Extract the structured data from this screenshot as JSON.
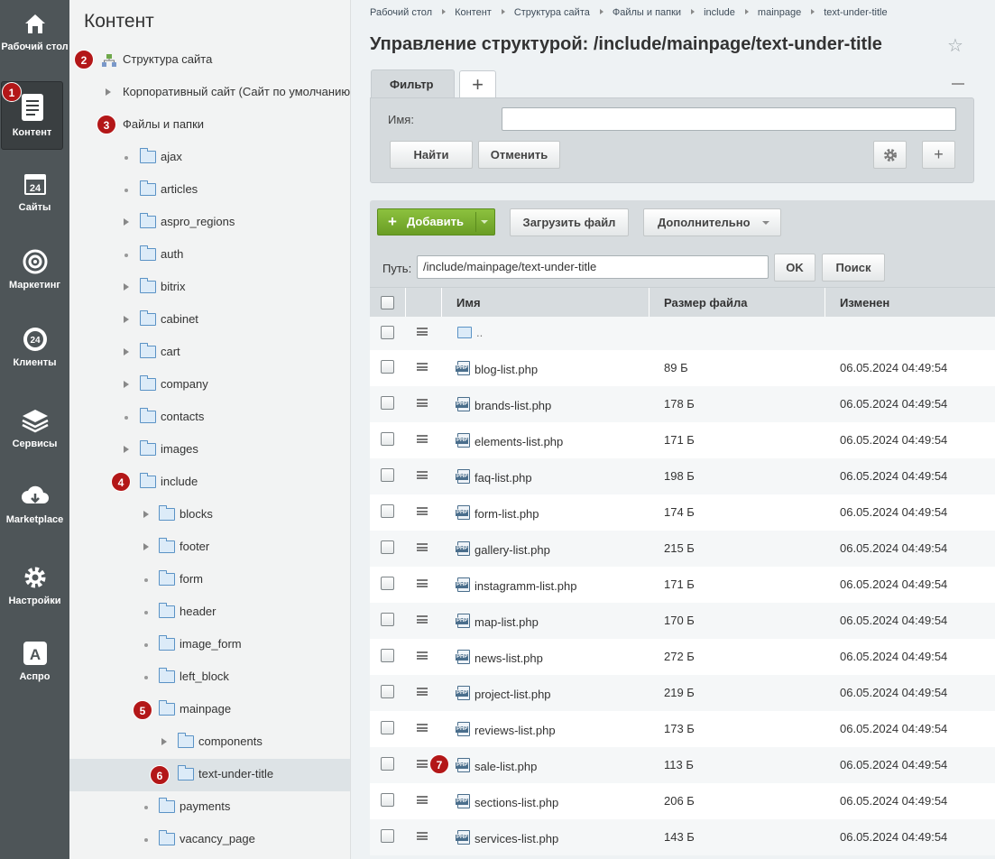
{
  "rail": [
    {
      "label": "Рабочий стол",
      "icon": "home-icon"
    },
    {
      "label": "Контент",
      "icon": "document-icon",
      "active": true
    },
    {
      "label": "Сайты",
      "icon": "calendar-24-icon"
    },
    {
      "label": "Маркетинг",
      "icon": "target-icon"
    },
    {
      "label": "Клиенты",
      "icon": "clients-24-icon"
    },
    {
      "label": "Сервисы",
      "icon": "layers-icon"
    },
    {
      "label": "Marketplace",
      "icon": "cloud-download-icon"
    },
    {
      "label": "Настройки",
      "icon": "gear-icon"
    },
    {
      "label": "Аспро",
      "icon": "aspro-a-icon"
    }
  ],
  "rail_badge": "1",
  "tree": {
    "title": "Контент",
    "site_structure": "Структура сайта",
    "corporate_site": "Корпоративный сайт (Сайт по умолчанию)",
    "files_and_folders": "Файлы и папки",
    "badges": {
      "site_structure": "2",
      "files_and_folders": "3",
      "include": "4",
      "mainpage": "5",
      "text_under_title": "6"
    },
    "items": [
      "ajax",
      "articles",
      "aspro_regions",
      "auth",
      "bitrix",
      "cabinet",
      "cart",
      "company",
      "contacts",
      "images",
      "include",
      "blocks",
      "footer",
      "form",
      "header",
      "image_form",
      "left_block",
      "mainpage",
      "components",
      "text-under-title",
      "payments",
      "vacancy_page"
    ]
  },
  "breadcrumb": [
    "Рабочий стол",
    "Контент",
    "Структура сайта",
    "Файлы и папки",
    "include",
    "mainpage",
    "text-under-title"
  ],
  "page_title": "Управление структурой: /include/mainpage/text-under-title",
  "filter": {
    "tab_label": "Фильтр",
    "add_tab": "+",
    "name_label": "Имя:",
    "name_value": "",
    "find_label": "Найти",
    "cancel_label": "Отменить",
    "add_field": "+"
  },
  "toolbar": {
    "add_label": "Добавить",
    "upload_label": "Загрузить файл",
    "more_label": "Дополнительно",
    "path_label": "Путь:",
    "path_value": "/include/mainpage/text-under-title",
    "ok_label": "OK",
    "search_label": "Поиск"
  },
  "table": {
    "headers": {
      "name": "Имя",
      "size": "Размер файла",
      "modified": "Изменен"
    },
    "up_label": "..",
    "row_badge": "7",
    "rows": [
      {
        "name": "blog-list.php",
        "size": "89 Б",
        "modified": "06.05.2024 04:49:54"
      },
      {
        "name": "brands-list.php",
        "size": "178 Б",
        "modified": "06.05.2024 04:49:54"
      },
      {
        "name": "elements-list.php",
        "size": "171 Б",
        "modified": "06.05.2024 04:49:54"
      },
      {
        "name": "faq-list.php",
        "size": "198 Б",
        "modified": "06.05.2024 04:49:54"
      },
      {
        "name": "form-list.php",
        "size": "174 Б",
        "modified": "06.05.2024 04:49:54"
      },
      {
        "name": "gallery-list.php",
        "size": "215 Б",
        "modified": "06.05.2024 04:49:54"
      },
      {
        "name": "instagramm-list.php",
        "size": "171 Б",
        "modified": "06.05.2024 04:49:54"
      },
      {
        "name": "map-list.php",
        "size": "170 Б",
        "modified": "06.05.2024 04:49:54"
      },
      {
        "name": "news-list.php",
        "size": "272 Б",
        "modified": "06.05.2024 04:49:54"
      },
      {
        "name": "project-list.php",
        "size": "219 Б",
        "modified": "06.05.2024 04:49:54"
      },
      {
        "name": "reviews-list.php",
        "size": "173 Б",
        "modified": "06.05.2024 04:49:54"
      },
      {
        "name": "sale-list.php",
        "size": "113 Б",
        "modified": "06.05.2024 04:49:54"
      },
      {
        "name": "sections-list.php",
        "size": "206 Б",
        "modified": "06.05.2024 04:49:54"
      },
      {
        "name": "services-list.php",
        "size": "143 Б",
        "modified": "06.05.2024 04:49:54"
      }
    ]
  }
}
